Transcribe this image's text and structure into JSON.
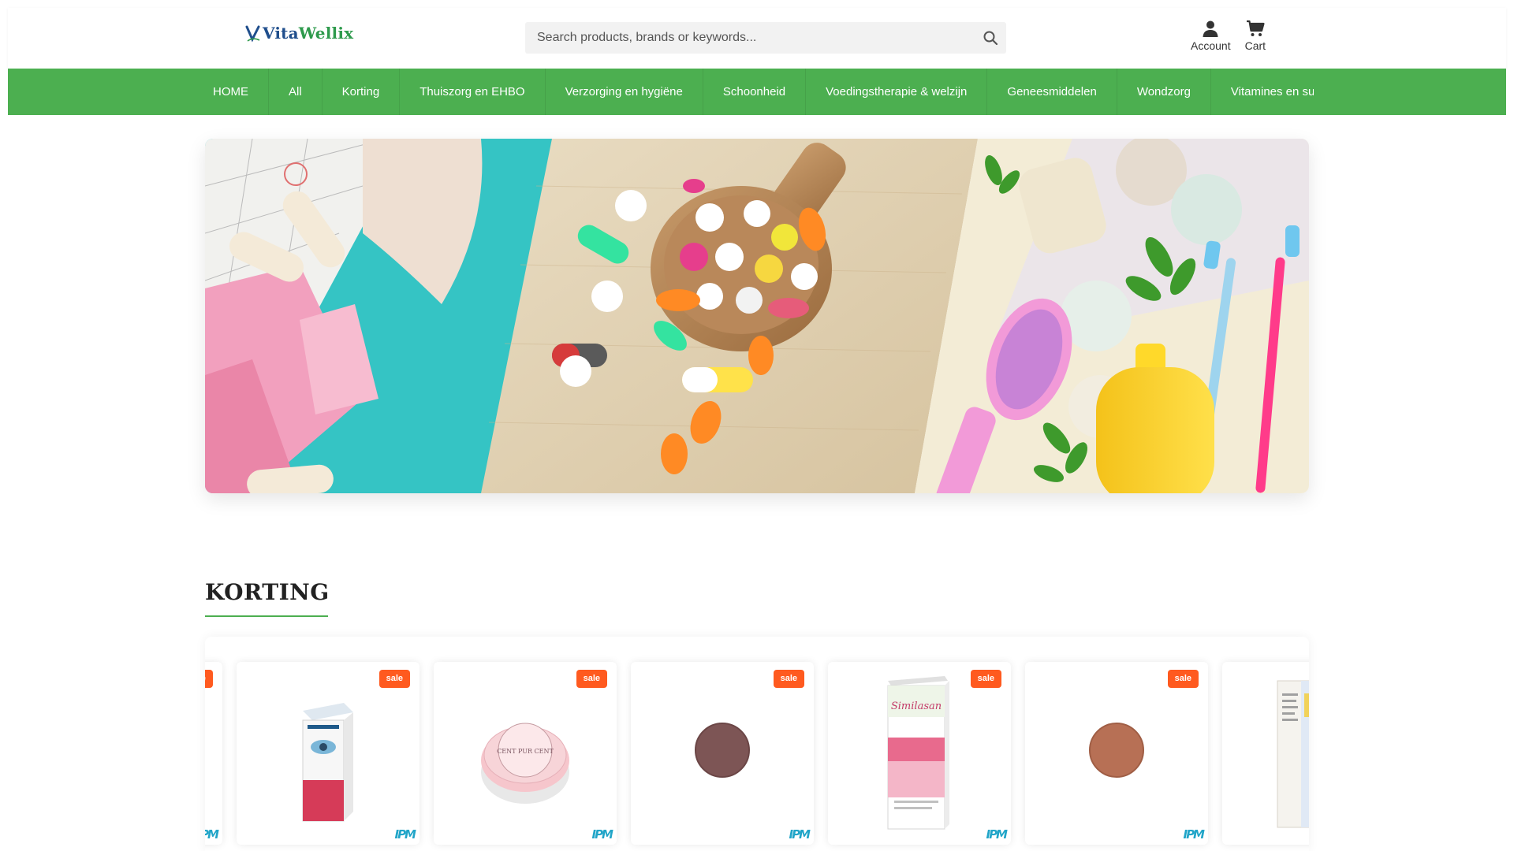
{
  "header": {
    "logo": {
      "text_main": "Vita",
      "text_accent": "Wellix"
    },
    "search": {
      "placeholder": "Search products, brands or keywords..."
    },
    "actions": [
      {
        "label": "Account",
        "icon": "user-icon"
      },
      {
        "label": "Cart",
        "icon": "cart-icon"
      }
    ]
  },
  "nav": {
    "items": [
      "HOME",
      "All",
      "Korting",
      "Thuiszorg en EHBO",
      "Verzorging en hygiëne",
      "Schoonheid",
      "Voedingstherapie & welzijn",
      "Geneesmiddelen",
      "Wondzorg",
      "Vitamines en supplementen"
    ]
  },
  "banner": {
    "description_icon": "hero-banner-image"
  },
  "section": {
    "title": "KORTING"
  },
  "products": [
    {
      "badge": "sale",
      "brand_mark": "IPM",
      "kind": "eye-drops-box"
    },
    {
      "badge": "sale",
      "brand_mark": "IPM",
      "kind": "powder-jar"
    },
    {
      "badge": "sale",
      "brand_mark": "IPM",
      "kind": "eyeshadow-pan-brown"
    },
    {
      "badge": "sale",
      "brand_mark": "IPM",
      "kind": "similasan-box"
    },
    {
      "badge": "sale",
      "brand_mark": "IPM",
      "kind": "eyeshadow-pan-copper"
    },
    {
      "badge": "sale",
      "brand_mark": "IPM",
      "kind": "product-box-partial"
    }
  ],
  "colors": {
    "nav_green": "#4caf50",
    "sale_orange": "#ff5a1f",
    "brand_blue": "#21a5c8",
    "logo_blue": "#1f4e8c"
  }
}
